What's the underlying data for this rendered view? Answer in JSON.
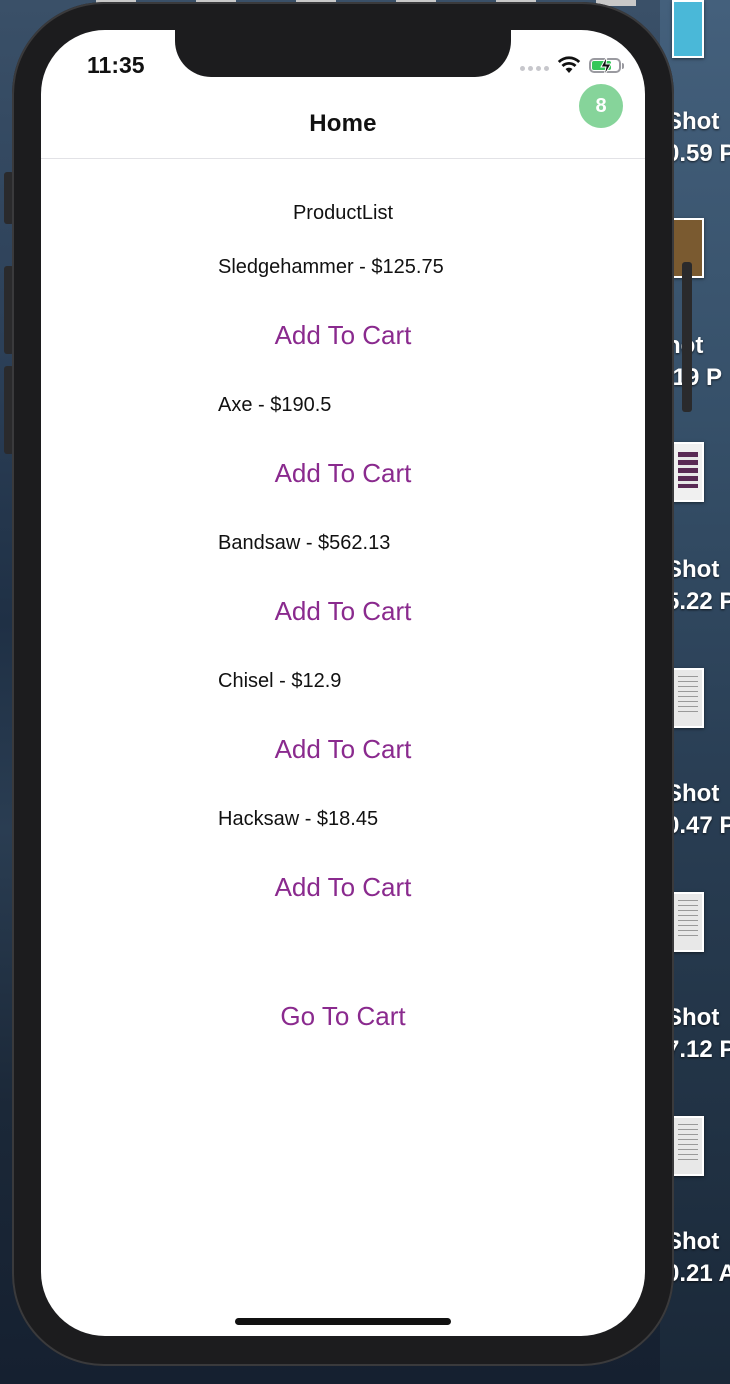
{
  "status_bar": {
    "time": "11:35"
  },
  "nav": {
    "title": "Home",
    "cart_count": "8"
  },
  "product_list": {
    "title": "ProductList",
    "add_label": "Add To Cart",
    "items": [
      {
        "label": "Sledgehammer - $125.75"
      },
      {
        "label": "Axe - $190.5"
      },
      {
        "label": "Bandsaw - $562.13"
      },
      {
        "label": "Chisel - $12.9"
      },
      {
        "label": "Hacksaw - $18.45"
      }
    ]
  },
  "go_to_cart_label": "Go To Cart",
  "desktop": {
    "labels": [
      "Shot\n0.59 P",
      "hot\n.19 P",
      "Shot\n5.22 P",
      "Shot\n0.47 P",
      "Shot\n7.12 P",
      "Shot\n0.21 A"
    ]
  },
  "colors": {
    "accent": "#8a2a8e",
    "badge": "#86d49a",
    "battery": "#35c759"
  }
}
